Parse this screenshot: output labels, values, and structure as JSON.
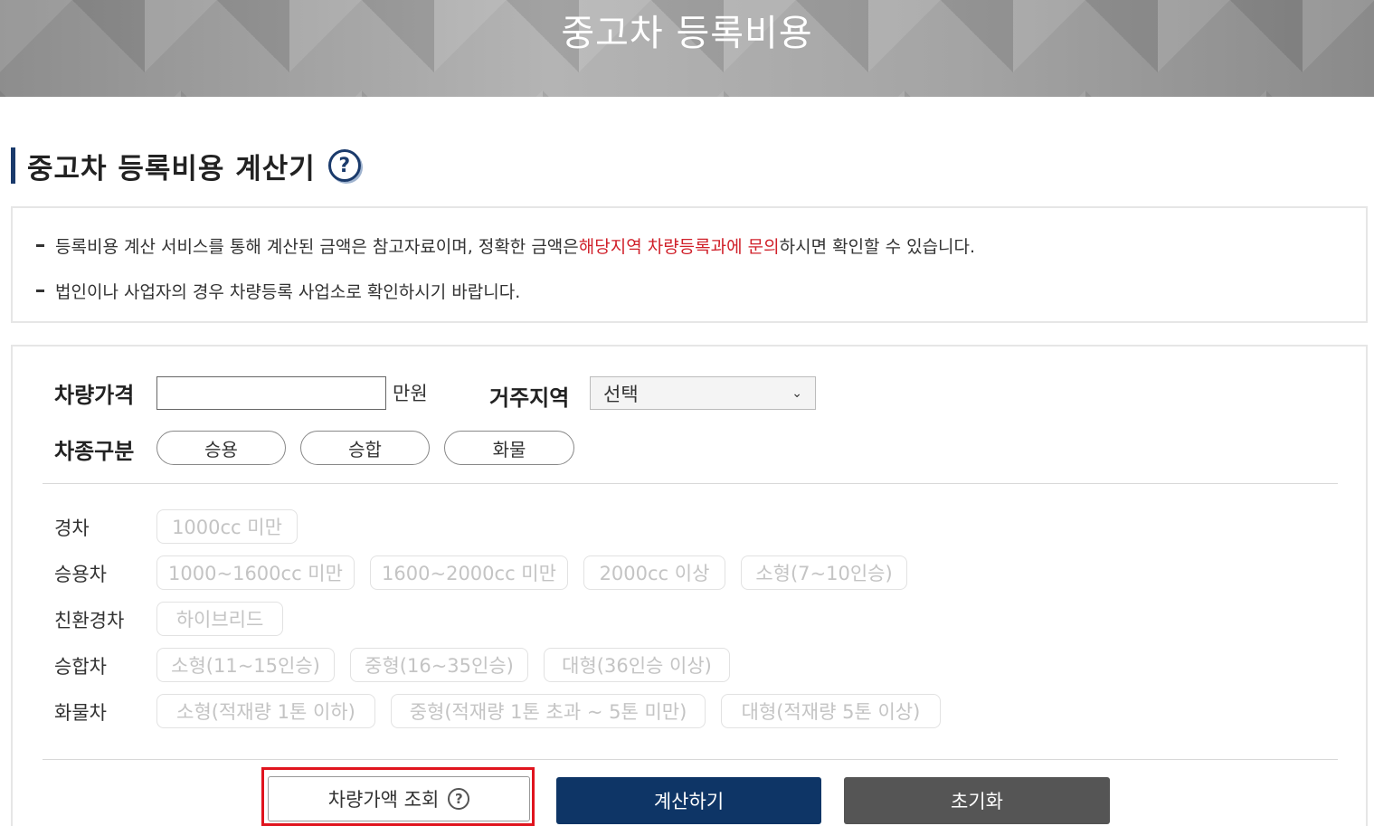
{
  "banner": {
    "title": "중고차 등록비용"
  },
  "section": {
    "title": "중고차 등록비용 계산기"
  },
  "notice": {
    "line1_pre": "등록비용 계산 서비스를 통해 계산된 금액은 참고자료이며, 정확한 금액은 ",
    "line1_highlight": "해당지역 차량등록과에 문의",
    "line1_post": "하시면 확인할 수 있습니다.",
    "line2": "법인이나 사업자의 경우 차량등록 사업소로 확인하시기 바랍니다."
  },
  "form": {
    "price_label": "차량가격",
    "price_value": "",
    "price_unit": "만원",
    "region_label": "거주지역",
    "region_selected": "선택",
    "type_label": "차종구분",
    "types": [
      "승용",
      "승합",
      "화물"
    ]
  },
  "categories": [
    {
      "label": "경차",
      "options": [
        "1000cc 미만"
      ]
    },
    {
      "label": "승용차",
      "options": [
        "1000~1600cc 미만",
        "1600~2000cc 미만",
        "2000cc 이상",
        "소형(7~10인승)"
      ]
    },
    {
      "label": "친환경차",
      "options": [
        "하이브리드"
      ]
    },
    {
      "label": "승합차",
      "options": [
        "소형(11~15인승)",
        "중형(16~35인승)",
        "대형(36인승 이상)"
      ]
    },
    {
      "label": "화물차",
      "options": [
        "소형(적재량 1톤 이하)",
        "중형(적재량 1톤 초과 ~ 5톤 미만)",
        "대형(적재량 5톤 이상)"
      ]
    }
  ],
  "buttons": {
    "lookup": "차량가액 조회",
    "calculate": "계산하기",
    "reset": "초기화"
  },
  "colors": {
    "accent": "#0e3566",
    "highlight": "#d0202a",
    "reset": "#555555"
  },
  "icons": {
    "help": "question-circle-icon",
    "dropdown": "chevron-down-icon"
  }
}
